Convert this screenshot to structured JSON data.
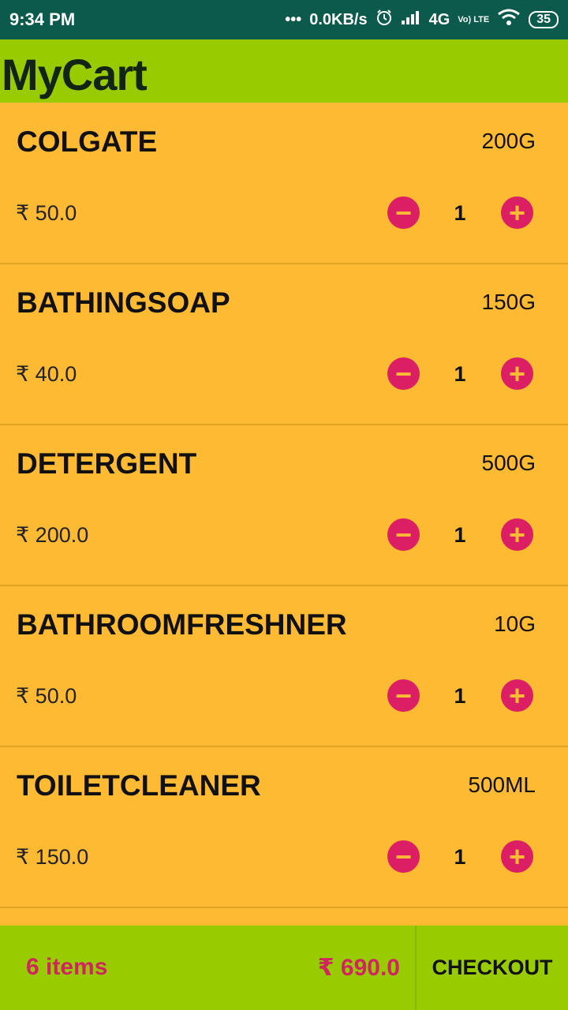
{
  "status_bar": {
    "time": "9:34 PM",
    "dots": "•••",
    "speed": "0.0KB/s",
    "alarm_icon": "alarm-icon",
    "signal": "4G",
    "volte": "Vo) LTE",
    "wifi_icon": "wifi-icon",
    "battery": "35"
  },
  "app_bar": {
    "title": "MyCart"
  },
  "colors": {
    "status_bar": "#0b5a4c",
    "app_bar": "#99cc00",
    "list_bg": "#ffba33",
    "accent": "#dc1f64"
  },
  "cart": {
    "currency": "₹",
    "items": [
      {
        "name": "COLGATE",
        "size": "200G",
        "price": "₹ 50.0",
        "qty": "1"
      },
      {
        "name": "BATHINGSOAP",
        "size": "150G",
        "price": "₹ 40.0",
        "qty": "1"
      },
      {
        "name": "DETERGENT",
        "size": "500G",
        "price": "₹ 200.0",
        "qty": "1"
      },
      {
        "name": "BATHROOMFRESHNER",
        "size": "10G",
        "price": "₹ 50.0",
        "qty": "1"
      },
      {
        "name": "TOILETCLEANER",
        "size": "500ML",
        "price": "₹ 150.0",
        "qty": "1"
      }
    ],
    "minus_label": "−",
    "plus_label": "+"
  },
  "footer": {
    "items_count": "6 items",
    "total": "₹ 690.0",
    "checkout_label": "CHECKOUT"
  }
}
